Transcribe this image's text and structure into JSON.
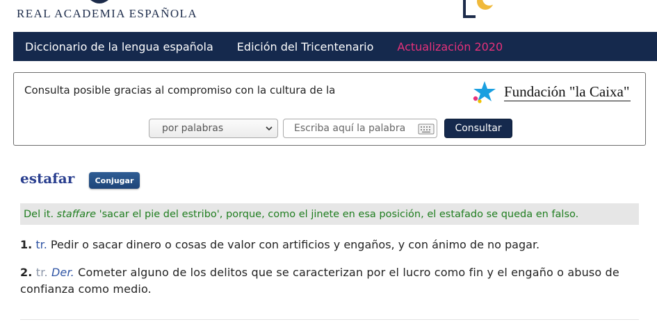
{
  "header": {
    "logo_text": "REAL ACADEMIA ESPAÑOLA"
  },
  "nav": {
    "items": [
      {
        "label": "Diccionario de la lengua española"
      },
      {
        "label": "Edición del Tricentenario"
      },
      {
        "label": "Actualización 2020"
      }
    ],
    "accent_color": "#e8317a",
    "bar_color": "#15294d"
  },
  "search": {
    "sponsor_text": "Consulta posible gracias al compromiso con la cultura de la",
    "sponsor_name": "Fundación \"la Caixa\"",
    "select_value": "por palabras",
    "input_placeholder": "Escriba aquí la palabra",
    "submit_label": "Consultar",
    "icons": [
      "chevron-down-icon",
      "keyboard-icon"
    ]
  },
  "entry": {
    "headword": "estafar",
    "conjugar_label": "Conjugar",
    "etymology": {
      "prefix": "Del it.",
      "italic_word": "staffare",
      "rest": "'sacar el pie del estribo', porque, como el jinete en esa posición, el estafado se queda en falso."
    },
    "acepciones": [
      {
        "num": "1.",
        "abbr": "tr.",
        "text": "Pedir o sacar dinero o cosas de valor con artificios y engaños, y con ánimo de no pagar."
      },
      {
        "num": "2.",
        "abbr": "tr.",
        "abbr2": "Der.",
        "text": "Cometer alguno de los delitos que se caracterizan por el lucro como fin y el engaño o abuso de confianza como medio."
      }
    ],
    "etymology_color": "#1f7d1f",
    "abbr_color": "#2f54a4"
  }
}
